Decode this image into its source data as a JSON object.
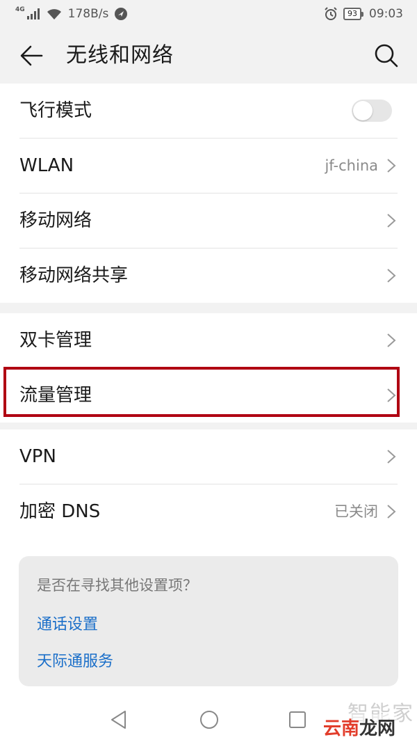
{
  "status_bar": {
    "network_label": "4G",
    "speed": "178B/s",
    "battery": "93",
    "time": "09:03"
  },
  "header": {
    "title": "无线和网络"
  },
  "group1": {
    "airplane": {
      "label": "飞行模式",
      "toggle_on": false
    },
    "wlan": {
      "label": "WLAN",
      "value": "jf-china"
    },
    "mobile_network": {
      "label": "移动网络"
    },
    "tethering": {
      "label": "移动网络共享"
    }
  },
  "group2": {
    "dual_sim": {
      "label": "双卡管理"
    },
    "data_usage": {
      "label": "流量管理"
    }
  },
  "group3": {
    "vpn": {
      "label": "VPN"
    },
    "private_dns": {
      "label": "加密 DNS",
      "value": "已关闭"
    }
  },
  "suggestions": {
    "question": "是否在寻找其他设置项？",
    "links": [
      "通话设置",
      "天际通服务"
    ]
  },
  "watermark": {
    "top": "智能家",
    "main_a": "云南",
    "main_b": "龙网"
  },
  "colors": {
    "highlight": "#b00012",
    "link": "#1b6fc9"
  }
}
